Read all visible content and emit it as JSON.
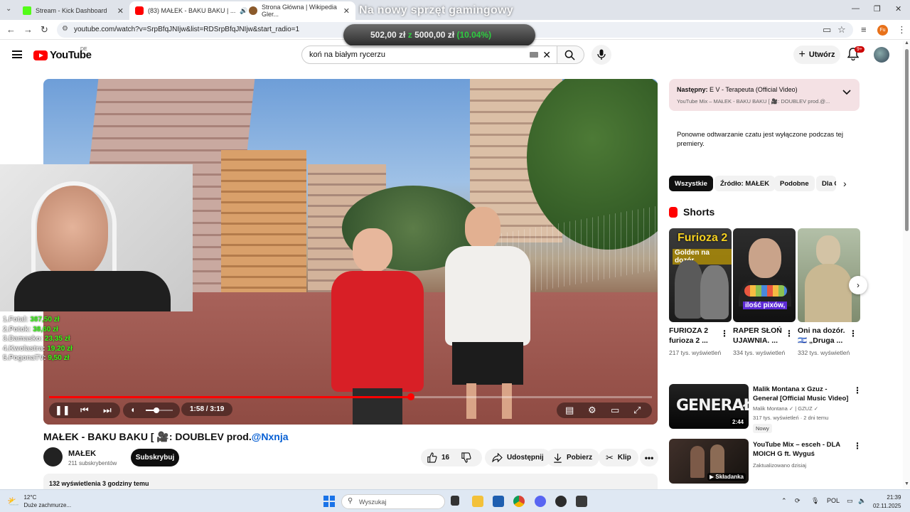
{
  "browser": {
    "tabs": [
      {
        "label": "Stream - Kick Dashboard",
        "color": "#53fc18"
      },
      {
        "label": "(83) MAŁEK - BAKU BAKU | ...",
        "color": "#ff0000"
      },
      {
        "label": "Strona Główna | Wikipedia Gler...",
        "color": "#8b5a2b"
      }
    ],
    "url": "youtube.com/watch?v=SrpBfqJNIjw&list=RDSrpBfqJNIjw&start_radio=1",
    "profile_initials": "Fu"
  },
  "stream_overlay": {
    "title": "Na nowy sprzęt gamingowy",
    "current": "502,00 zł",
    "separator": "z",
    "goal": "5000,00 zł",
    "percent": "(10.04%)"
  },
  "youtube": {
    "logo_text": "YouTube",
    "region": "DE",
    "search_value": "koń na białym rycerzu",
    "create_label": "Utwórz",
    "notif_count": "9+"
  },
  "player": {
    "progress": 0.6,
    "time": "1:58 / 3:19"
  },
  "webcam_leaderboard": [
    {
      "prefix": "1.Fotal: ",
      "amount": "387,50 zł"
    },
    {
      "prefix": "2.Potok: ",
      "amount": "38,60 zł"
    },
    {
      "prefix": "3.Damasko: ",
      "amount": "23,35 zł"
    },
    {
      "prefix": "4.Kwolastra: ",
      "amount": "19,20 zł"
    },
    {
      "prefix": "5.PogonaTV: ",
      "amount": "9,50 zł"
    }
  ],
  "video": {
    "title_main": "MAŁEK - BAKU BAKU [ 🎥: DOUBLEV prod.",
    "title_tag": "@Nxnja",
    "channel": "MAŁEK",
    "subscribers": "211 subskrybentów",
    "subscribe_label": "Subskrybuj",
    "likes": "16",
    "share_label": "Udostępnij",
    "download_label": "Pobierz",
    "clip_label": "Klip",
    "desc_meta": "132 wyświetlenia  3 godziny temu"
  },
  "sidebar": {
    "up_next_prefix": "Następny:",
    "up_next_title": " E V - Terapeuta (Official Video)",
    "up_next_sub": "YouTube Mix – MAŁEK - BAKU BAKU [ 🎥: DOUBLEV prod.@...",
    "chat_note": "Ponowne odtwarzanie czatu jest wyłączone podczas tej premiery.",
    "chips": [
      "Wszystkie",
      "Źródło: MAŁEK",
      "Podobne",
      "Dla Ciebie"
    ],
    "shorts_heading": "Shorts",
    "shorts": [
      {
        "title": "FURIOZA 2 furioza 2 ...",
        "views": "217 tys. wyświetleń",
        "overlay_top": "Furioza 2",
        "overlay_sub": "Golden na dozór"
      },
      {
        "title": "RAPER SŁOŃ UJAWNIA. ...",
        "views": "334 tys. wyświetleń",
        "overlay_top": "",
        "overlay_sub": "ilość pixów,"
      },
      {
        "title": "Oni na dozór. 🇮🇱 „Druga ...",
        "views": "332 tys. wyświetleń",
        "overlay_top": "",
        "overlay_sub": ""
      }
    ],
    "recs": [
      {
        "title": "Malik Montana x Gzuz - Generał [Official Music Video]",
        "channel": "Malik Montana ✓ | GZUZ ✓",
        "meta": "317 tys. wyświetleń · 2 dni temu",
        "badge": "Nowy",
        "duration": "2:44",
        "thumb_text": "GENERAŁ"
      },
      {
        "title": "YouTube Mix – esceh - DLA MOICH G ft. Wyguś",
        "channel": "Zaktualizowano dzisiaj",
        "meta": "",
        "badge": "",
        "duration": "Składanka",
        "thumb_text": ""
      }
    ]
  },
  "taskbar": {
    "temp": "12°C",
    "weather": "Duże zachmurze...",
    "search_placeholder": "Wyszukaj",
    "lang": "POL",
    "time": "21:39",
    "date": "02.11.2025"
  }
}
